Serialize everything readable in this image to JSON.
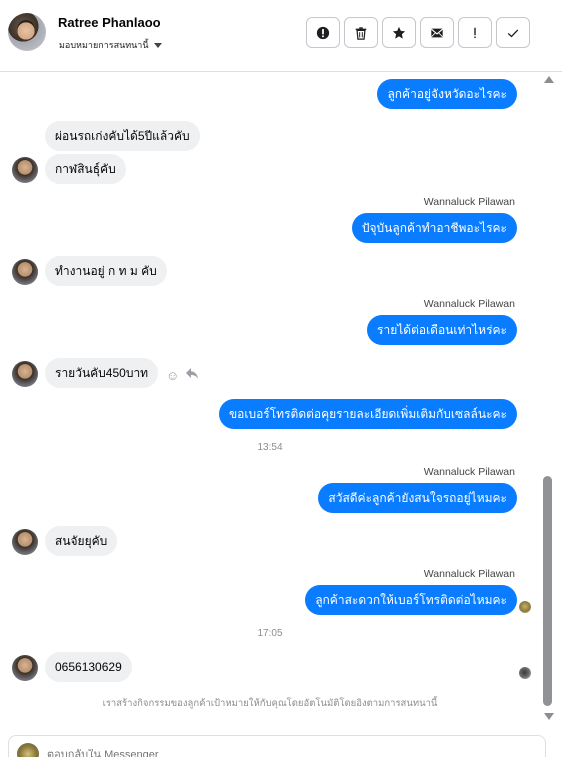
{
  "header": {
    "contact_name": "Ratree Phanlaoo",
    "assign_label": "มอบหมายการสนทนานี้",
    "toolbar": [
      "report-icon",
      "trash-icon",
      "star-icon",
      "mail-icon",
      "exclamation-icon",
      "check-icon"
    ]
  },
  "messages": {
    "m1": "ลูกค้าอยู่จังหวัดอะไรคะ",
    "m2": "ผ่อนรถเก่งคับได้5ปีแล้วคับ",
    "m3": "กาฬสินธุ์คับ",
    "m4_sender": "Wannaluck Pilawan",
    "m4": "ปัจุบันลูกค้าทำอาชีพอะไรคะ",
    "m5": "ทำงานอยู่ ก ท ม คับ",
    "m6_sender": "Wannaluck Pilawan",
    "m6": "รายได้ต่อเดือนเท่าไหร่คะ",
    "m7": "รายวันคับ450บาท",
    "m8": "ขอเบอร์โทรติดต่อคุยรายละเอียดเพิ่มเติมกับเซลล์นะคะ",
    "ts1": "13:54",
    "m9_sender": "Wannaluck Pilawan",
    "m9": "สวัสดีค่ะลูกค้ายังสนใจรถอยู่ไหมคะ",
    "m10": "สนจัยยุคับ",
    "m11_sender": "Wannaluck Pilawan",
    "m11": "ลูกค้าสะดวกให้เบอร์โทรติดต่อไหมคะ",
    "ts2": "17:05",
    "m12": "0656130629"
  },
  "notice": "เราสร้างกิจกรรมของลูกค้าเป้าหมายให้กับคุณโดยอัตโนมัติโดยอิงตามการสนทนานี้",
  "composer": {
    "placeholder": "ตอบกลับใน Messenger"
  },
  "colors": {
    "outgoing_bubble": "#0a7cff",
    "incoming_bubble": "#eef0f2"
  }
}
